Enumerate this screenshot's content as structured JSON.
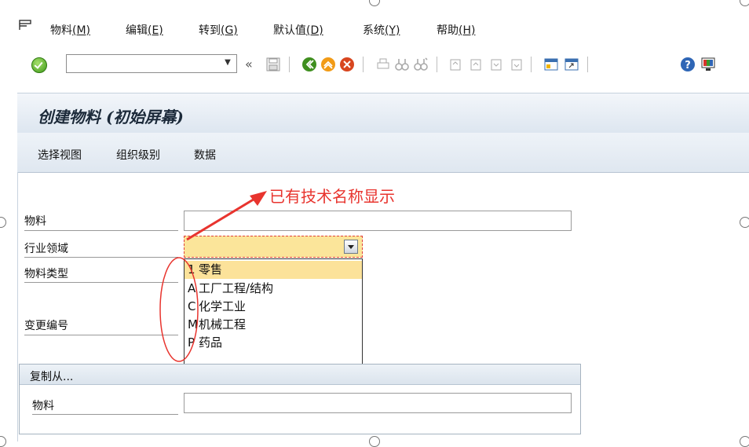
{
  "menubar": {
    "items": [
      {
        "label": "物料",
        "key": "(M)"
      },
      {
        "label": "编辑",
        "key": "(E)"
      },
      {
        "label": "转到",
        "key": "(G)"
      },
      {
        "label": "默认值",
        "key": "(D)"
      },
      {
        "label": "系统",
        "key": "(Y)"
      },
      {
        "label": "帮助",
        "key": "(H)"
      }
    ]
  },
  "toolbar": {
    "command_value": "",
    "back_glyph": "«"
  },
  "screen": {
    "title": "创建物料 (初始屏幕)",
    "app_buttons": [
      "选择视图",
      "组织级别",
      "数据"
    ]
  },
  "form": {
    "material_label": "物料",
    "material_value": "",
    "industry_label": "行业领域",
    "material_type_label": "物料类型",
    "change_number_label": "变更编号"
  },
  "dropdown": {
    "options": [
      {
        "key": "1",
        "text": "零售",
        "selected": true
      },
      {
        "key": "A",
        "text": "工厂工程/结构",
        "selected": false
      },
      {
        "key": "C",
        "text": "化学工业",
        "selected": false
      },
      {
        "key": "M",
        "text": "机械工程",
        "selected": false
      },
      {
        "key": "P",
        "text": "药品",
        "selected": false
      }
    ]
  },
  "copy_from": {
    "title": "复制从...",
    "material_label": "物料",
    "material_value": ""
  },
  "annotation": {
    "text": "已有技术名称显示",
    "color": "#e8342e"
  },
  "colors": {
    "selected_bg": "#fce29a",
    "header_gradient_top": "#f3f6fa",
    "header_gradient_bottom": "#dde6f0"
  }
}
